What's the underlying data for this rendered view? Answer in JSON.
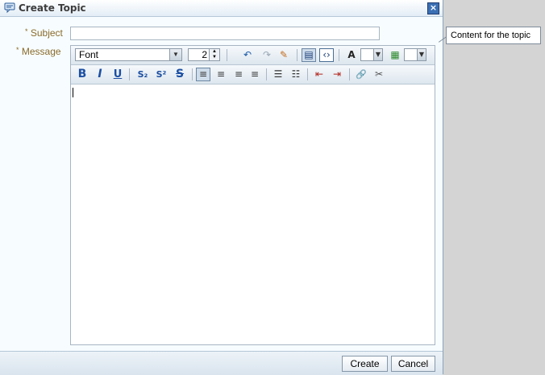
{
  "dialog": {
    "title": "Create Topic",
    "close_symbol": "×"
  },
  "form": {
    "subject_label": "Subject",
    "message_label": "Message",
    "required_marker": "*",
    "subject_value": ""
  },
  "tooltip": {
    "text": "Content for the topic"
  },
  "toolbar": {
    "font_value": "Font",
    "size_value": "2",
    "icons": {
      "undo": "↶",
      "redo": "↷",
      "erase": "✎",
      "rich_mode": "▤",
      "source_mode": "‹›",
      "text_color": "A",
      "bg_color": "▦",
      "bold": "B",
      "italic": "I",
      "underline": "U",
      "subscript": "S₂",
      "superscript": "S²",
      "strike": "S",
      "align_left": "≡",
      "align_center": "≡",
      "align_right": "≡",
      "justify": "≡",
      "bullets": "☰",
      "numbers": "☷",
      "outdent": "⇤",
      "indent": "⇥",
      "link": "🔗",
      "unlink": "✂"
    }
  },
  "buttons": {
    "create": "Create",
    "cancel": "Cancel"
  }
}
